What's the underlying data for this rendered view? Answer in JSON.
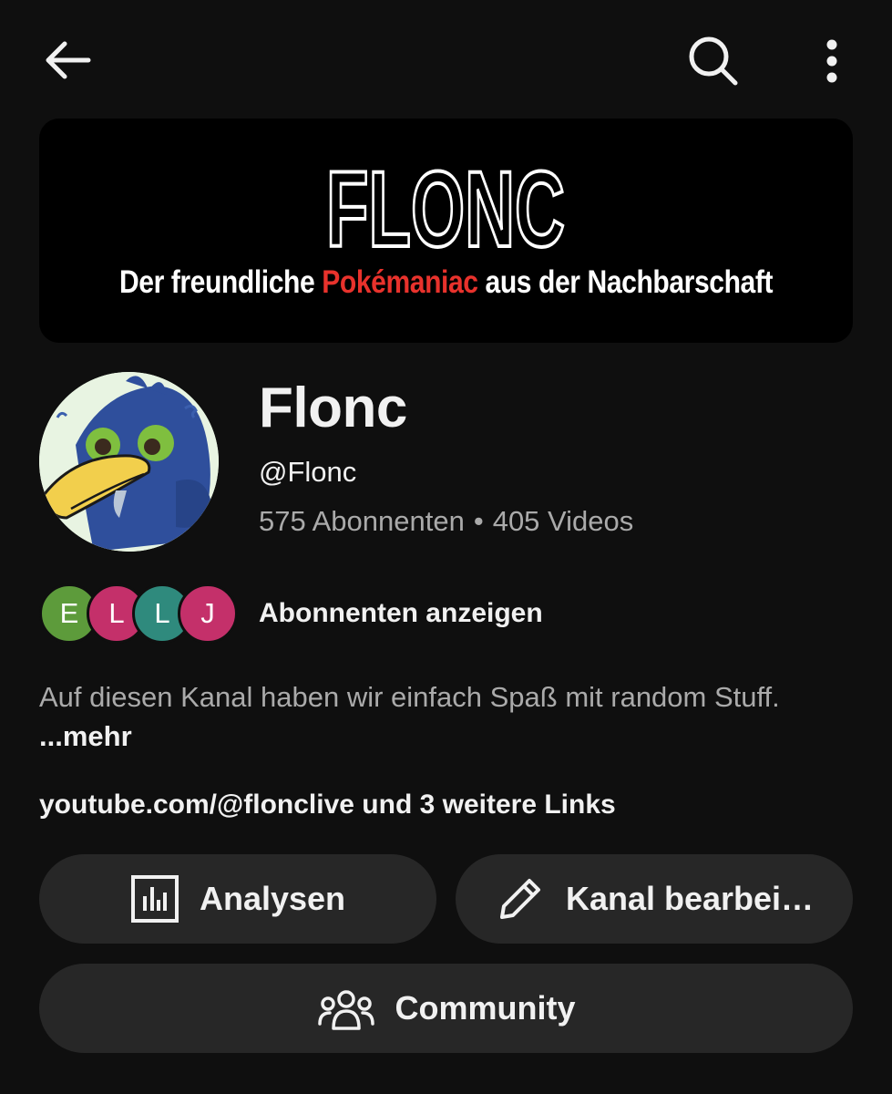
{
  "topbar": {
    "back_icon": "arrow-left-icon",
    "search_icon": "search-icon",
    "more_icon": "more-vertical-icon"
  },
  "banner": {
    "logo_text": "FLONC",
    "subtitle_before": "Der freundliche ",
    "subtitle_highlight": "Pokémaniac",
    "subtitle_after": " aus der Nachbarschaft",
    "highlight_color": "#e8322c"
  },
  "channel": {
    "name": "Flonc",
    "handle": "@Flonc",
    "subscribers": "575 Abonnenten",
    "separator": "•",
    "videos": "405 Videos"
  },
  "subscribers_preview": {
    "avatars": [
      {
        "letter": "E",
        "color": "#5d9b3b"
      },
      {
        "letter": "L",
        "color": "#c4306a"
      },
      {
        "letter": "L",
        "color": "#2f8a7d"
      },
      {
        "letter": "J",
        "color": "#c4306a"
      }
    ],
    "label": "Abonnenten anzeigen"
  },
  "description": {
    "text": "Auf diesen Kanal haben wir einfach Spaß mit random Stuff. ",
    "more_label": "...mehr"
  },
  "links": {
    "url": "youtube.com/@flonclive",
    "more": " und 3 weitere Links"
  },
  "buttons": {
    "analytics_label": "Analysen",
    "analytics_icon": "bar-chart-icon",
    "edit_label": "Kanal bearbei…",
    "edit_icon": "pencil-icon",
    "community_label": "Community",
    "community_icon": "people-icon"
  }
}
